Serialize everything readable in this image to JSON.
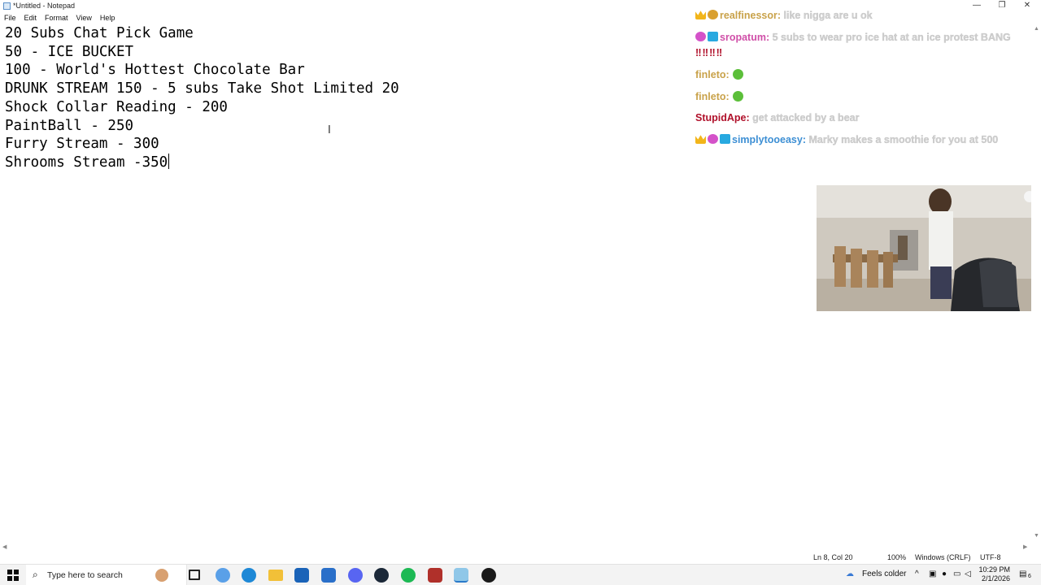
{
  "window": {
    "title": "*Untitled - Notepad",
    "minimize": "—",
    "restore": "❐",
    "close": "✕"
  },
  "menu": [
    "File",
    "Edit",
    "Format",
    "View",
    "Help"
  ],
  "editor": {
    "lines": [
      "20 Subs Chat Pick Game",
      "50 - ICE BUCKET",
      "100 - World's Hottest Chocolate Bar",
      "DRUNK STREAM 150 - 5 subs Take Shot Limited 20",
      "Shock Collar Reading - 200",
      "PaintBall - 250",
      "Furry Stream - 300",
      "Shrooms Stream -350"
    ]
  },
  "chat": [
    {
      "user": "realfinessor:",
      "user_color": "#c9a24a",
      "text": "like nigga are u ok",
      "badges": [
        "crown",
        "gold"
      ]
    },
    {
      "user": "sropatum:",
      "user_color": "#d04fa8",
      "text": "5 subs to wear pro ice hat at an ice protest BANG",
      "bang": "‼‼‼‼",
      "badges": [
        "pink",
        "cube"
      ]
    },
    {
      "user": "finleto:",
      "user_color": "#c9a24a",
      "text": "",
      "emote": "sick",
      "badges": []
    },
    {
      "user": "finleto:",
      "user_color": "#c9a24a",
      "text": "",
      "emote": "sick",
      "badges": []
    },
    {
      "user": "StupidApe:",
      "user_color": "#b0102a",
      "text": "get attacked by a bear",
      "badges": []
    },
    {
      "user": "simplytooeasy:",
      "user_color": "#3d8fd4",
      "text": "Marky makes a smoothie for you at 500",
      "badges": [
        "crown",
        "pink",
        "cube"
      ]
    }
  ],
  "status": {
    "position": "Ln 8, Col 20",
    "zoom": "100%",
    "line_ending": "Windows (CRLF)",
    "encoding": "UTF-8"
  },
  "taskbar": {
    "search_placeholder": "Type here to search",
    "weather": "Feels colder",
    "time": "10:29 PM",
    "date": "2/1/2026",
    "notification_count": "6"
  }
}
